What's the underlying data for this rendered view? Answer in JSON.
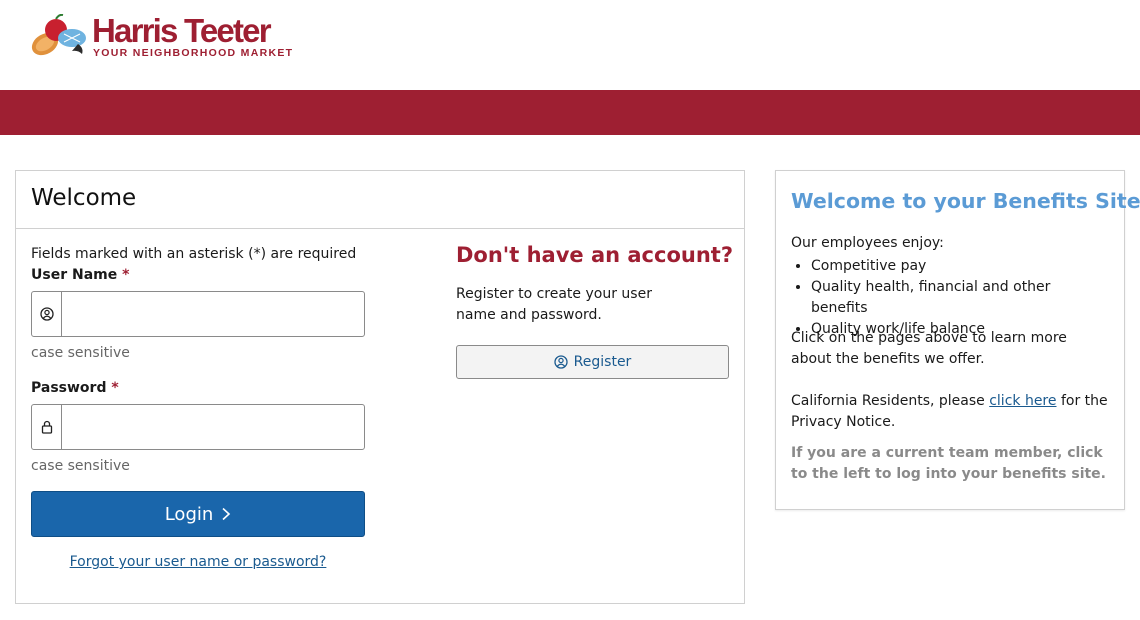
{
  "brand": {
    "name": "Harris Teeter",
    "tagline": "YOUR NEIGHBORHOOD MARKET",
    "color": "#9e1f32"
  },
  "login": {
    "title": "Welcome",
    "required_note": "Fields marked with an asterisk (*) are required",
    "username": {
      "label": "User Name",
      "asterisk": "*",
      "value": "",
      "placeholder": "",
      "hint": "case sensitive",
      "icon": "user-circle-icon"
    },
    "password": {
      "label": "Password",
      "asterisk": "*",
      "value": "",
      "placeholder": "",
      "hint": "case sensitive",
      "icon": "lock-icon"
    },
    "login_button": "Login",
    "forgot_link": "Forgot your user name or password?"
  },
  "register": {
    "heading": "Don't have an account?",
    "text": "Register to create your user name and password.",
    "button": "Register"
  },
  "benefits": {
    "title": "Welcome to your Benefits Site",
    "intro": "Our employees enjoy:",
    "items": [
      "Competitive pay",
      "Quality health, financial and other benefits",
      "Quality work/life balance"
    ],
    "paragraph": "Click on the pages above to learn more about the benefits we offer.",
    "ca_prefix": "California Residents, please",
    "ca_link": "click here",
    "ca_suffix": "for the Privacy Notice.",
    "note": "If you are a current team member, click to the left to log into your benefits site."
  },
  "colors": {
    "brand_red": "#9e1f32",
    "login_blue": "#1a66ab",
    "title_blue": "#5b9bd5"
  }
}
